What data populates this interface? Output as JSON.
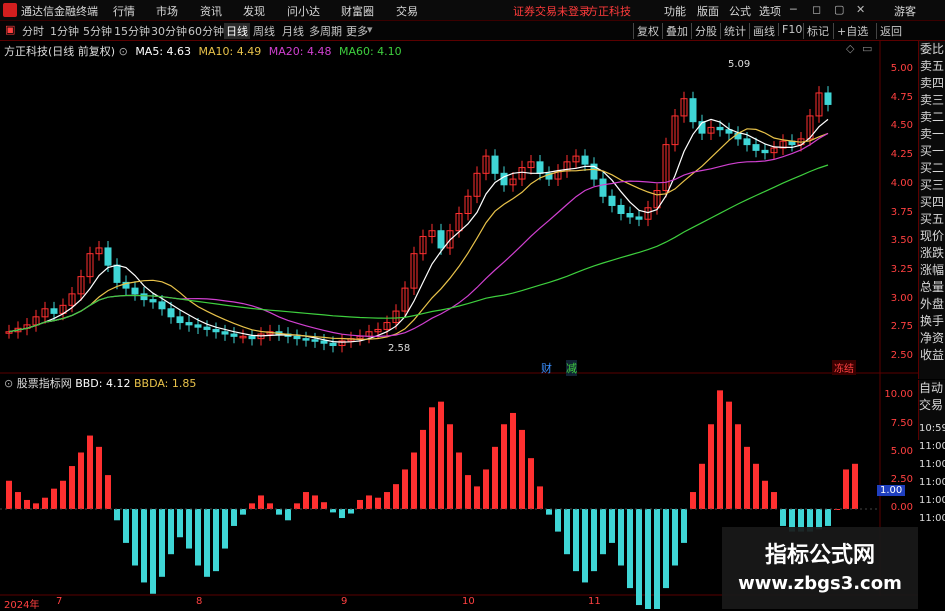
{
  "menubar": {
    "app_title": "通达信金融终端",
    "items": [
      "行情",
      "市场",
      "资讯",
      "发现",
      "问小达",
      "财富圈",
      "交易"
    ],
    "notice": "证券交易未登录",
    "stock_name": "方正科技",
    "right_items": [
      "功能",
      "版面",
      "公式",
      "选项"
    ],
    "guest": "游客"
  },
  "tabbar": {
    "periods": [
      "分时",
      "1分钟",
      "5分钟",
      "15分钟",
      "30分钟",
      "60分钟",
      "日线",
      "周线",
      "月线",
      "多周期",
      "更多"
    ],
    "active": "日线",
    "right_buttons": [
      "复权",
      "叠加",
      "分股",
      "统计",
      "画线",
      "F10",
      "标记",
      "+自选",
      "返回"
    ]
  },
  "main_chart": {
    "title": "方正科技(日线 前复权)",
    "ma": [
      {
        "label": "MA5: 4.63",
        "color": "#ffffff"
      },
      {
        "label": "MA10: 4.49",
        "color": "#e8c24a"
      },
      {
        "label": "MA20: 4.48",
        "color": "#d040d0"
      },
      {
        "label": "MA60: 4.10",
        "color": "#3ecf3e"
      }
    ],
    "y_ticks": [
      "5.00",
      "4.75",
      "4.50",
      "4.25",
      "4.00",
      "3.75",
      "3.50",
      "3.25",
      "3.00",
      "2.75",
      "2.50"
    ],
    "high_label": "5.09",
    "low_label": "2.58",
    "badges": [
      {
        "text": "财",
        "color": "#3a8fff"
      },
      {
        "text": "减",
        "color": "#3ecf3e"
      },
      {
        "text": "冻结",
        "color": "#ff4040"
      }
    ]
  },
  "indicator_chart": {
    "title": "股票指标网",
    "bbd_label": "BBD: 4.12",
    "bbda_label": "BBDA: 1.85",
    "y_ticks": [
      "10.00",
      "7.50",
      "5.00",
      "2.50",
      "0.00"
    ],
    "marker_value": "1.00"
  },
  "right_panel": {
    "items": [
      "委比",
      "卖五",
      "卖四",
      "卖三",
      "卖二",
      "卖一",
      "买一",
      "买二",
      "买三",
      "买四",
      "买五",
      "现价",
      "涨跌",
      "涨幅",
      "总量",
      "外盘",
      "换手",
      "净资",
      "收益"
    ],
    "lower_items": [
      "自动",
      "交易"
    ],
    "time_slots": [
      "10:59",
      "11:00",
      "11:00",
      "11:00",
      "11:00",
      "11:00"
    ]
  },
  "date_axis": [
    "2024年",
    "7",
    "8",
    "9",
    "10",
    "11"
  ],
  "watermark": {
    "title": "指标公式网",
    "url": "www.zbgs3.com"
  },
  "colors": {
    "up": "#ff3030",
    "down": "#3fd6d6",
    "ma5": "#ffffff",
    "ma10": "#e8c24a",
    "ma20": "#d040d0",
    "ma60": "#3ecf3e",
    "axis": "#ff4040"
  }
}
